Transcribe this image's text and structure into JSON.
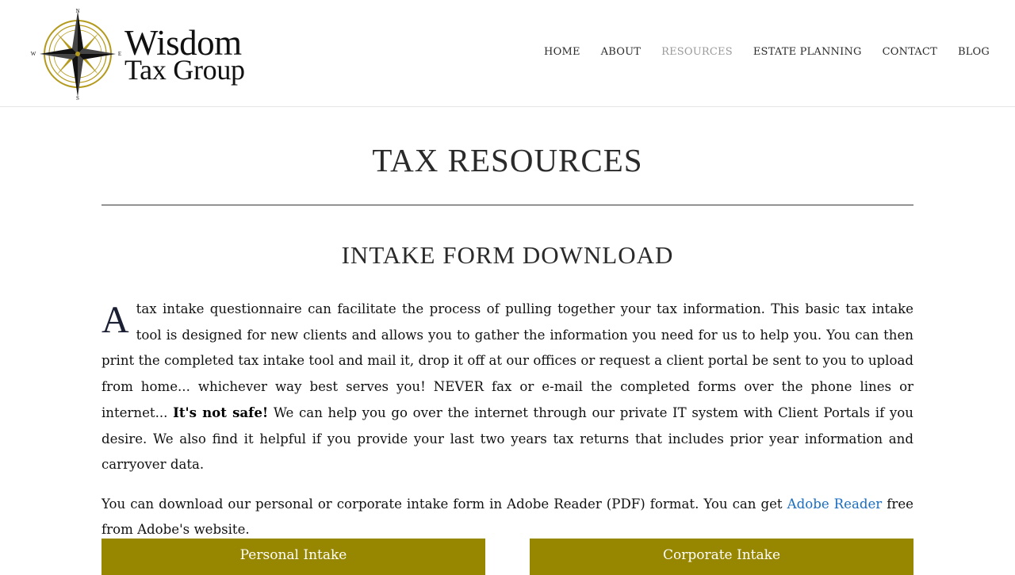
{
  "brand": {
    "line1": "Wisdom",
    "line2": "Tax Group",
    "compass": {
      "n": "N",
      "s": "S",
      "e": "E",
      "w": "W"
    },
    "colors": {
      "gold": "#b49a1c"
    }
  },
  "nav": {
    "items": [
      {
        "label": "HOME",
        "active": false
      },
      {
        "label": "ABOUT",
        "active": false
      },
      {
        "label": "RESOURCES",
        "active": true
      },
      {
        "label": "ESTATE PLANNING",
        "active": false
      },
      {
        "label": "CONTACT",
        "active": false
      },
      {
        "label": "BLOG",
        "active": false
      }
    ]
  },
  "page": {
    "title": "TAX RESOURCES",
    "section_title": "INTAKE FORM DOWNLOAD",
    "para1": {
      "dropcap": "A",
      "text_before_bold": "tax intake questionnaire can facilitate the process of pulling together your tax information. This basic tax intake tool is designed for new clients and allows you to gather the information you need for us to help you. You can then print the completed tax intake tool and mail it, drop it off at our offices or request a client portal be sent to you to upload from home... whichever way best serves you! NEVER fax or e-mail the completed forms over the phone lines or internet...",
      "bold": "It's not safe!",
      "text_after_bold": "We can help you go over the internet through our private IT system with Client Portals if you desire. We also find it helpful if you provide your last two years tax returns that includes prior year information and carryover data."
    },
    "para2": {
      "text_before_link": "You can download our personal or corporate intake form in Adobe Reader (PDF) format. You can get",
      "link": "Adobe Reader",
      "text_after_link": "free from Adobe's website."
    },
    "buttons": {
      "personal": "Personal Intake",
      "corporate": "Corporate Intake"
    },
    "colors": {
      "button": "#978600",
      "link": "#1a6dbf"
    }
  }
}
